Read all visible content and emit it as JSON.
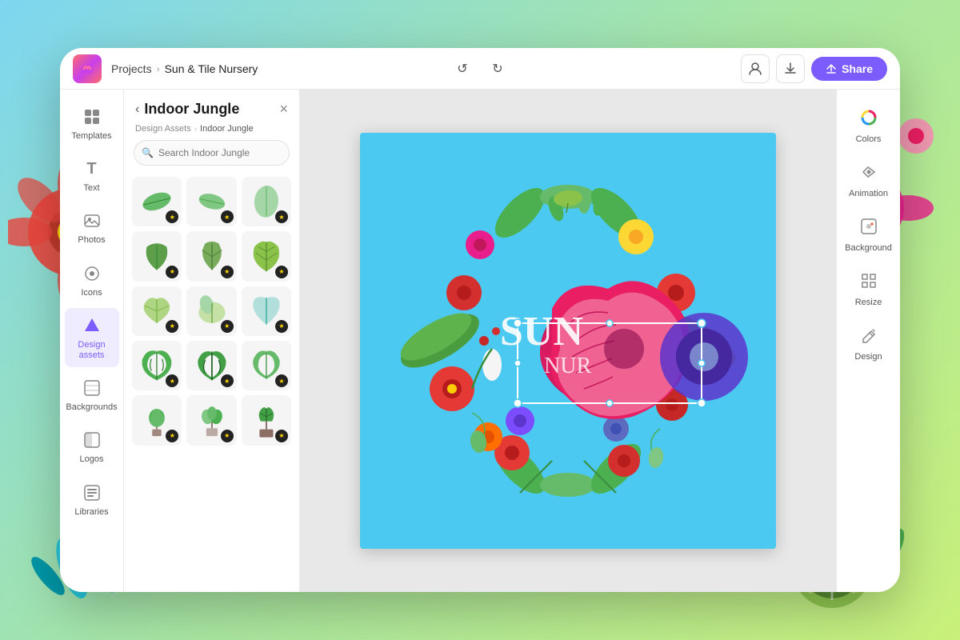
{
  "background": {
    "gradient_start": "#7dd6f0",
    "gradient_mid": "#a8e6a3",
    "gradient_end": "#c8f07a"
  },
  "topbar": {
    "logo_alt": "Adobe Express",
    "breadcrumb_root": "Projects",
    "breadcrumb_sep": "›",
    "breadcrumb_current": "Sun & Tile Nursery",
    "undo_label": "↺",
    "redo_label": "↻",
    "share_label": "Share",
    "download_icon": "download",
    "profile_icon": "profile"
  },
  "sidebar": {
    "items": [
      {
        "id": "templates",
        "label": "Templates",
        "icon": "⊞"
      },
      {
        "id": "text",
        "label": "Text",
        "icon": "T"
      },
      {
        "id": "photos",
        "label": "Photos",
        "icon": "🖼"
      },
      {
        "id": "icons",
        "label": "Icons",
        "icon": "◎"
      },
      {
        "id": "design-assets",
        "label": "Design assets",
        "icon": "▲",
        "active": true
      },
      {
        "id": "backgrounds",
        "label": "Backgrounds",
        "icon": "⬡"
      },
      {
        "id": "logos",
        "label": "Logos",
        "icon": "◧"
      },
      {
        "id": "libraries",
        "label": "Libraries",
        "icon": "⬜"
      }
    ]
  },
  "panel": {
    "back_label": "‹",
    "title": "Indoor Jungle",
    "close_label": "×",
    "breadcrumb_root": "Design Assets",
    "breadcrumb_sep": "›",
    "breadcrumb_current": "Indoor Jungle",
    "search_placeholder": "Search Indoor Jungle",
    "search_icon": "🔍"
  },
  "right_panel": {
    "items": [
      {
        "id": "colors",
        "label": "Colors",
        "icon": "🎨"
      },
      {
        "id": "animation",
        "label": "Animation",
        "icon": "✦"
      },
      {
        "id": "background",
        "label": "Background",
        "icon": "⬡"
      },
      {
        "id": "resize",
        "label": "Resize",
        "icon": "⊞"
      },
      {
        "id": "design",
        "label": "Design",
        "icon": "✏"
      }
    ]
  },
  "canvas": {
    "design_name": "Sun & Tile Nursery",
    "text_line1": "SUN",
    "text_line2": "NUR",
    "bg_color": "#4cc9f0"
  }
}
